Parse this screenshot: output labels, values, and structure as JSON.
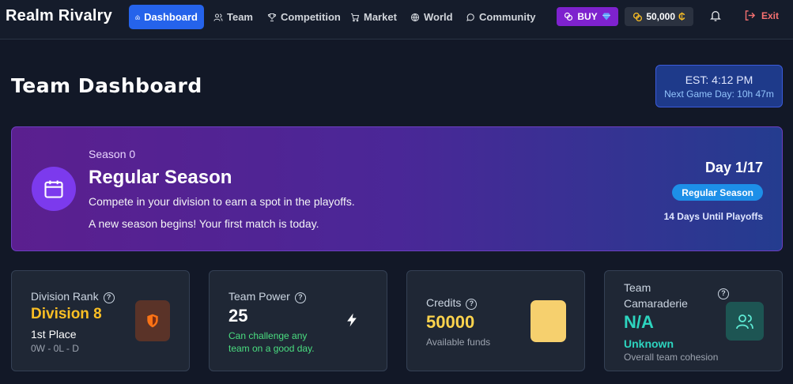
{
  "brand": "Realm Rivalry",
  "nav": {
    "items": [
      {
        "label": "Dashboard",
        "icon": "home-icon",
        "active": true
      },
      {
        "label": "Team",
        "icon": "users-icon",
        "active": false
      },
      {
        "label": "Competition",
        "icon": "trophy-icon",
        "active": false
      },
      {
        "label": "Market",
        "icon": "cart-icon",
        "active": false
      },
      {
        "label": "World",
        "icon": "globe-icon",
        "active": false
      },
      {
        "label": "Community",
        "icon": "chat-icon",
        "active": false
      }
    ],
    "buy_label": "BUY",
    "credits": "50,000",
    "exit_label": "Exit"
  },
  "header": {
    "title": "Team Dashboard",
    "clock_time": "EST: 4:12 PM",
    "clock_next": "Next Game Day: 10h 47m"
  },
  "season": {
    "label": "Season 0",
    "title": "Regular Season",
    "description": "Compete in your division to earn a spot in the playoffs.",
    "message": "A new season begins! Your first match is today.",
    "day": "Day 1/17",
    "phase": "Regular Season",
    "playoffs": "14 Days Until Playoffs"
  },
  "cards": {
    "division": {
      "label": "Division Rank",
      "value": "Division 8",
      "place": "1st Place",
      "record": "0W - 0L - D"
    },
    "power": {
      "label": "Team Power",
      "value": "25",
      "sub_line1": "Can challenge any",
      "sub_line2": "team on a good day."
    },
    "credits": {
      "label": "Credits",
      "value": "50000",
      "sub": "Available funds"
    },
    "camaraderie": {
      "label_line1": "Team",
      "label_line2": "Camaraderie",
      "value": "N/A",
      "status": "Unknown",
      "sub": "Overall team cohesion"
    }
  },
  "colors": {
    "accent": "#2563eb",
    "buy": "#7e22ce",
    "gold": "#fbbf24",
    "green": "#4ade80",
    "teal": "#2dd4bf",
    "exit": "#f87171"
  }
}
